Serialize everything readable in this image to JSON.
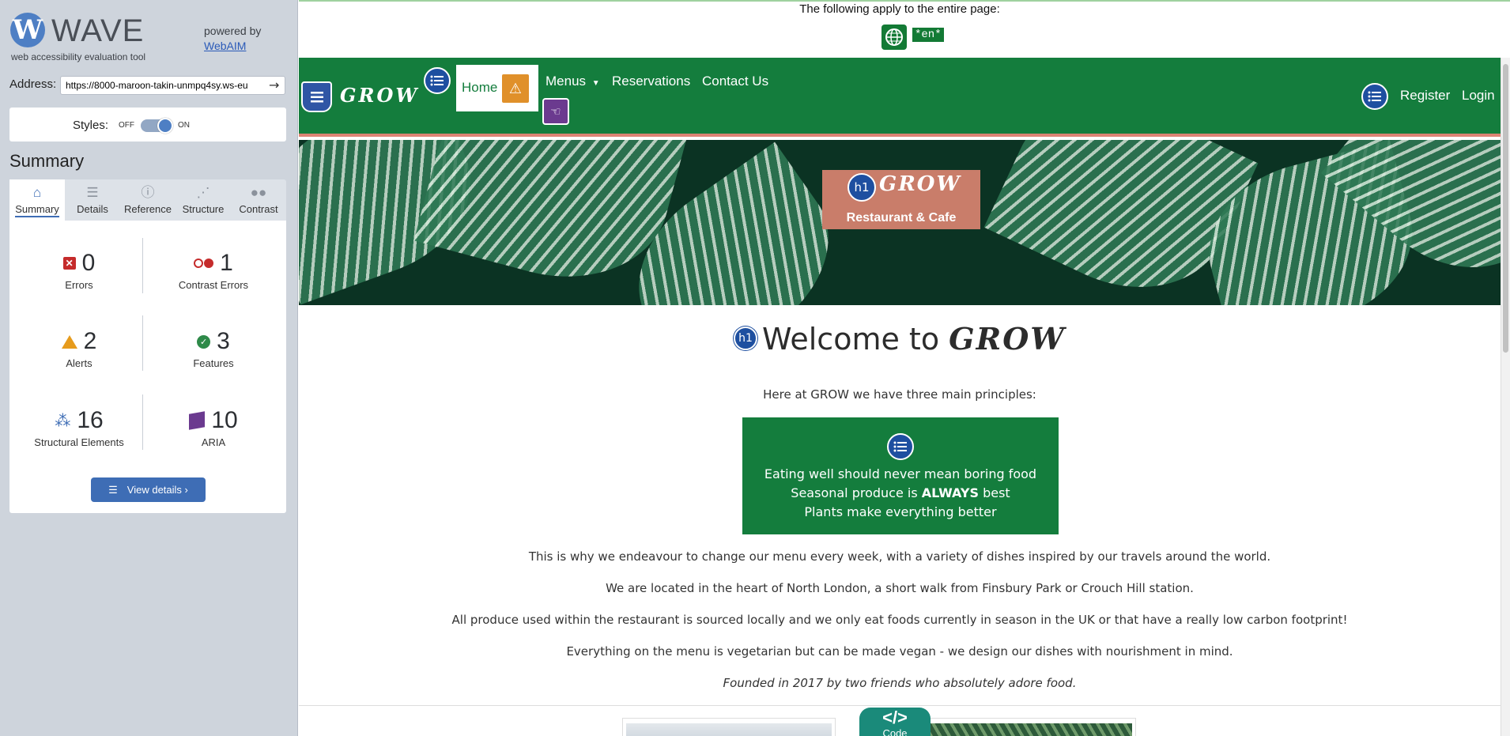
{
  "wave": {
    "logo_letter": "W",
    "title": "WAVE",
    "subtitle": "web accessibility evaluation tool",
    "powered_by": "powered by",
    "webaim_link": "WebAIM",
    "address_label": "Address:",
    "address_value": "https://8000-maroon-takin-unmpq4sy.ws-eu",
    "styles_label": "Styles:",
    "styles_off": "OFF",
    "styles_on": "ON",
    "styles_enabled": true,
    "summary_heading": "Summary",
    "tabs": [
      {
        "label": "Summary",
        "icon": "home-icon",
        "active": true
      },
      {
        "label": "Details",
        "icon": "list-icon",
        "active": false
      },
      {
        "label": "Reference",
        "icon": "info-icon",
        "active": false
      },
      {
        "label": "Structure",
        "icon": "structure-icon",
        "active": false
      },
      {
        "label": "Contrast",
        "icon": "contrast-toggle-icon",
        "active": false
      }
    ],
    "stats": {
      "errors": {
        "count": "0",
        "label": "Errors",
        "color": "#c52b2b"
      },
      "contrast_errors": {
        "count": "1",
        "label": "Contrast Errors",
        "color": "#c52b2b"
      },
      "alerts": {
        "count": "2",
        "label": "Alerts",
        "color": "#e69b1c"
      },
      "features": {
        "count": "3",
        "label": "Features",
        "color": "#2e8a49"
      },
      "structural": {
        "count": "16",
        "label": "Structural Elements",
        "color": "#3e6db5"
      },
      "aria": {
        "count": "10",
        "label": "ARIA",
        "color": "#6b3a8f"
      }
    },
    "view_details": "View details ›"
  },
  "page": {
    "applies_text": "The following apply to the entire page:",
    "lang_badge": "*en*",
    "brand": "GROW",
    "nav": {
      "home": "Home",
      "menus": "Menus",
      "reservations": "Reservations",
      "contact": "Contact Us",
      "register": "Register",
      "login": "Login"
    },
    "hero": {
      "h1_badge": "h1",
      "title": "GROW",
      "subtitle": "Restaurant & Cafe"
    },
    "welcome": {
      "h1_badge": "h1",
      "prefix": "Welcome to ",
      "brand": "GROW"
    },
    "intro": "Here at GROW we have three main principles:",
    "principles": [
      {
        "before": "Eating well should never mean boring food",
        "bold": "",
        "after": ""
      },
      {
        "before": "Seasonal produce is ",
        "bold": "ALWAYS",
        "after": " best"
      },
      {
        "before": "Plants make everything better",
        "bold": "",
        "after": ""
      }
    ],
    "paragraphs": [
      "This is why we endeavour to change our menu every week, with a variety of dishes inspired by our travels around the world.",
      "We are located in the heart of North London, a short walk from Finsbury Park or Crouch Hill station.",
      "All produce used within the restaurant is sourced locally and we only eat foods currently in season in the UK or that have a really low carbon footprint!",
      "Everything on the menu is vegetarian but can be made vegan - we design our dishes with nourishment in mind."
    ],
    "founded": "Founded in 2017 by two friends who absolutely adore food.",
    "code_tab": {
      "symbol": "</>",
      "label": "Code"
    },
    "colors": {
      "brand_green": "#147d3d",
      "accent_salmon": "#c97d6a",
      "wave_blue": "#3e6db5"
    }
  }
}
